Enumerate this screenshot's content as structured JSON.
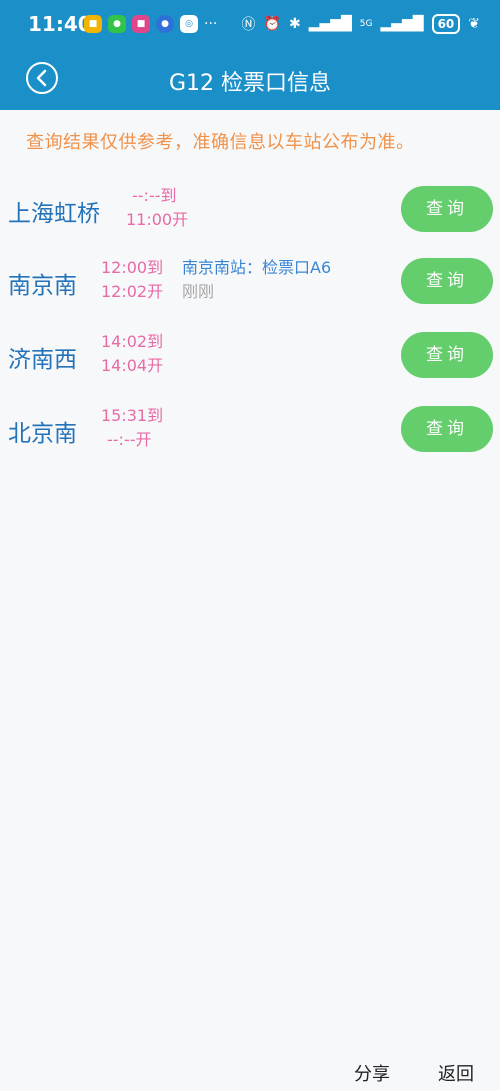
{
  "status_bar": {
    "time": "11:40",
    "signal_label": "5G",
    "battery": "60",
    "more": "···"
  },
  "header": {
    "title": "G12 检票口信息"
  },
  "notice": "查询结果仅供参考，准确信息以车站公布为准。",
  "stations": [
    {
      "name": "上海虹桥",
      "arrive": "--:--到",
      "depart": "11:00开",
      "gate": "",
      "updated": "",
      "button": "查询"
    },
    {
      "name": "南京南",
      "arrive": "12:00到",
      "depart": "12:02开",
      "gate": "南京南站：检票口A6",
      "updated": "刚刚",
      "button": "查询"
    },
    {
      "name": "济南西",
      "arrive": "14:02到",
      "depart": "14:04开",
      "gate": "",
      "updated": "",
      "button": "查询"
    },
    {
      "name": "北京南",
      "arrive": "15:31到",
      "depart": "--:--开",
      "gate": "",
      "updated": "",
      "button": "查询"
    }
  ],
  "footer": {
    "share": "分享",
    "back": "返回"
  },
  "colors": {
    "header_bg": "#1b8fc8",
    "notice": "#f0924a",
    "station": "#2472b8",
    "time": "#e86aa6",
    "gate": "#3a86d6",
    "button_bg": "#64cd6c"
  }
}
